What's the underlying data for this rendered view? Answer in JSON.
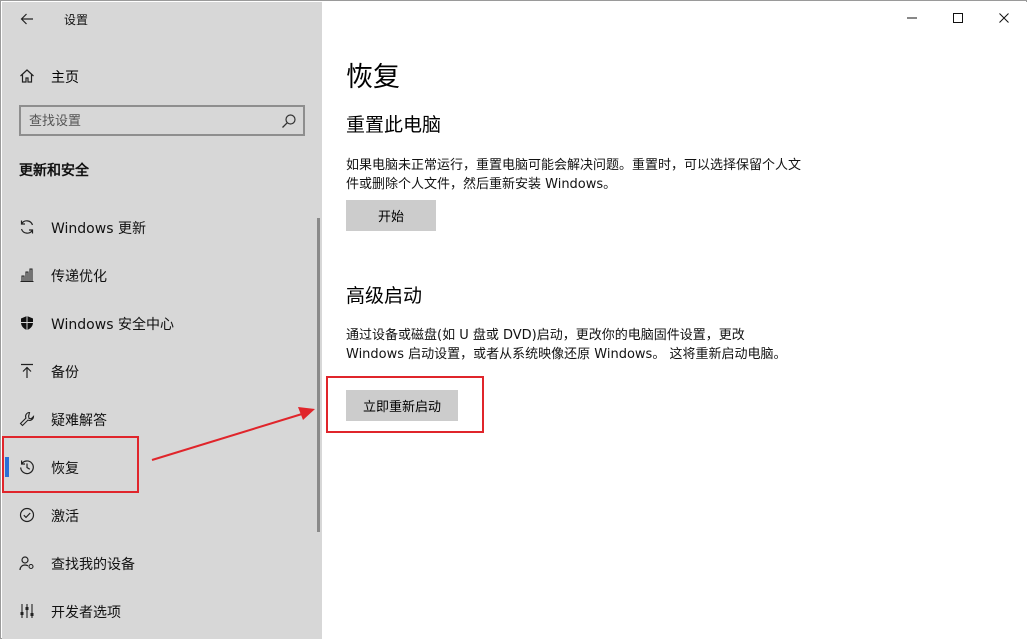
{
  "window": {
    "title": "设置",
    "controls": {
      "minimize": "minimize-icon",
      "maximize": "maximize-icon",
      "close": "close-icon"
    }
  },
  "sidebar": {
    "home_label": "主页",
    "search_placeholder": "查找设置",
    "section_title": "更新和安全",
    "items": [
      {
        "label": "Windows 更新",
        "icon": "sync-icon"
      },
      {
        "label": "传递优化",
        "icon": "delivery-optimization-icon"
      },
      {
        "label": "Windows 安全中心",
        "icon": "shield-icon"
      },
      {
        "label": "备份",
        "icon": "backup-upload-icon"
      },
      {
        "label": "疑难解答",
        "icon": "wrench-icon"
      },
      {
        "label": "恢复",
        "icon": "history-clock-icon",
        "selected": true
      },
      {
        "label": "激活",
        "icon": "check-circle-icon"
      },
      {
        "label": "查找我的设备",
        "icon": "person-locate-icon"
      },
      {
        "label": "开发者选项",
        "icon": "developer-options-icon"
      }
    ]
  },
  "main": {
    "title": "恢复",
    "reset": {
      "heading": "重置此电脑",
      "description": "如果电脑未正常运行，重置电脑可能会解决问题。重置时，可以选择保留个人文件或删除个人文件，然后重新安装 Windows。",
      "button_label": "开始"
    },
    "advanced": {
      "heading": "高级启动",
      "description": "通过设备或磁盘(如 U 盘或 DVD)启动，更改你的电脑固件设置，更改 Windows 启动设置，或者从系统映像还原 Windows。 这将重新启动电脑。",
      "button_label": "立即重新启动"
    }
  },
  "colors": {
    "sidebar_bg": "#d7d7d7",
    "selection_accent": "#2b6fd6",
    "button_bg": "#cccccc",
    "annotation_red": "#e0252b"
  }
}
